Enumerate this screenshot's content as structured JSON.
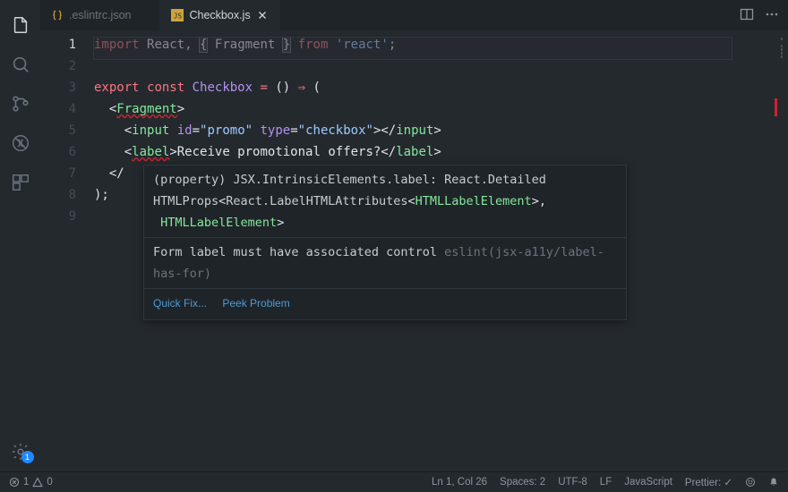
{
  "tabs": [
    {
      "name": ".eslintrc.json",
      "active": false
    },
    {
      "name": "Checkbox.js",
      "active": true
    }
  ],
  "gutter": {
    "activeLine": 1,
    "count": 9
  },
  "code": {
    "l1": {
      "import": "import",
      "react": "React",
      "frag": "Fragment",
      "from": "from",
      "mod": "'react'"
    },
    "l3": {
      "export": "export",
      "const": "const",
      "name": "Checkbox",
      "eq": "=",
      "arrow": "⇒",
      "open": "("
    },
    "l4": {
      "frag": "Fragment"
    },
    "l5": {
      "tag": "input",
      "attr_id": "id",
      "val_id": "\"promo\"",
      "attr_type": "type",
      "val_type": "\"checkbox\""
    },
    "l6": {
      "tag": "label",
      "text": "Receive promotional offers?"
    },
    "l7": {
      "close_prefix": "</"
    },
    "l8": {
      "close": ");"
    }
  },
  "hover": {
    "sig1": "(property) JSX.IntrinsicElements.label: React.Detailed",
    "sig2a": "HTMLProps",
    "sig2b": "React.LabelHTMLAttributes",
    "sig2c": "HTMLLabelElement",
    "sig3a": "HTMLLabelElement",
    "msg": "Form label must have associated control",
    "rule": "eslint(jsx-a11y/label-has-for)",
    "quickfix": "Quick Fix...",
    "peek": "Peek Problem"
  },
  "status": {
    "errors": "1",
    "warnings": "0",
    "ln": "Ln 1, Col 26",
    "spaces": "Spaces: 2",
    "encoding": "UTF-8",
    "eol": "LF",
    "lang": "JavaScript",
    "prettier": "Prettier: ✓",
    "settings_badge": "1"
  }
}
